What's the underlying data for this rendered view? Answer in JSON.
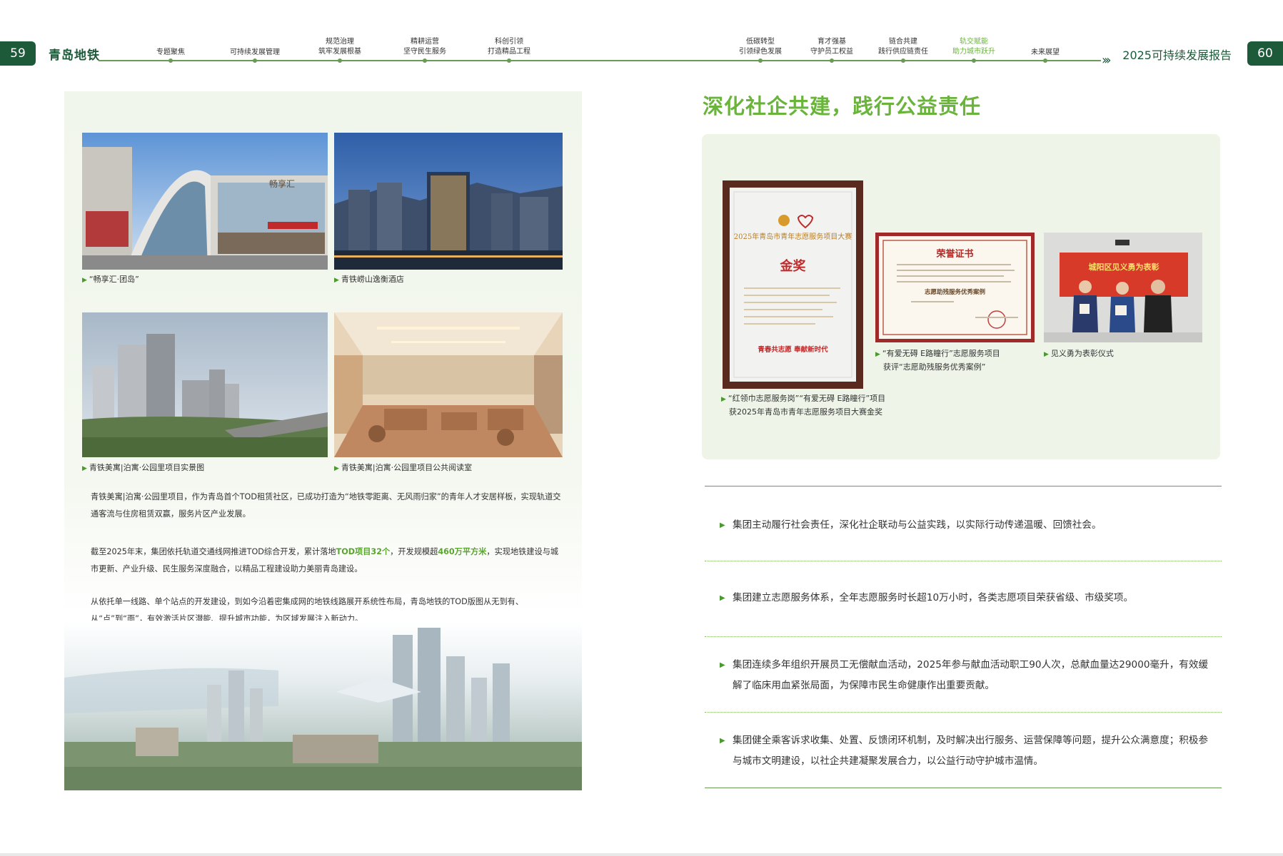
{
  "header": {
    "left_page_num": "59",
    "right_page_num": "60",
    "brand": "青岛地铁",
    "report_title": "2025可持续发展报告",
    "nav": [
      {
        "l1": "专题聚焦",
        "l2": ""
      },
      {
        "l1": "可持续发展管理",
        "l2": ""
      },
      {
        "l1": "规范治理",
        "l2": "筑牢发展根基"
      },
      {
        "l1": "精耕运营",
        "l2": "坚守民生服务"
      },
      {
        "l1": "科创引领",
        "l2": "打造精品工程"
      },
      {
        "l1": "低碳转型",
        "l2": "引领绿色发展"
      },
      {
        "l1": "育才强基",
        "l2": "守护员工权益"
      },
      {
        "l1": "链合共建",
        "l2": "践行供应链责任"
      },
      {
        "l1": "轨交赋能",
        "l2": "助力城市跃升"
      },
      {
        "l1": "未来展望",
        "l2": ""
      }
    ]
  },
  "left": {
    "captions": {
      "c1": "“畅享汇·团岛”",
      "c2": "青铁崂山逸衡酒店",
      "c3": "青铁美寓|泊寓·公园里项目实景图",
      "c4": "青铁美寓|泊寓·公园里项目公共阅读室"
    },
    "para1": "青铁美寓|泊寓·公园里项目，作为青岛首个TOD租赁社区，已成功打造为“地铁零距离、无风雨归家”的青年人才安居样板，实现轨道交通客流与住房租赁双赢，服务片区产业发展。",
    "para2_pre": "截至2025年末，集团依托轨道交通线网推进TOD综合开发，累计落地",
    "para2_hl1": "TOD项目32个",
    "para2_mid": "，开发规模超",
    "para2_hl2": "460万平方米",
    "para2_post": "，实现地铁建设与城市更新、产业升级、民生服务深度融合，以精品工程建设助力美丽青岛建设。",
    "para3": "从依托单一线路、单个站点的开发建设，到如今沿着密集成网的地铁线路展开系统性布局，青岛地铁的TOD版图从无到有、从“点”到“面”，有效激活片区潜能、提升城市功能，为区域发展注入新动力。",
    "sign_text": "畅享汇"
  },
  "right": {
    "title": "深化社企共建，践行公益责任",
    "award1": {
      "plaque_title": "2025年青岛市青年志愿服务项目大赛",
      "plaque_prize": "金奖",
      "plaque_slogan": "青春共志愿 奉献新时代",
      "caption_l1": "“红领巾志愿服务岗”“有爱无碍 E路瞳行”项目",
      "caption_l2": "获2025年青岛市青年志愿服务项目大赛金奖"
    },
    "award2": {
      "cert_title": "荣誉证书",
      "cert_case": "志愿助残服务优秀案例",
      "caption_l1": "“有爱无碍 E路瞳行”志愿服务项目",
      "caption_l2": "获评“志愿助残服务优秀案例”"
    },
    "award3": {
      "banner": "城阳区见义勇为表彰",
      "caption": "见义勇为表彰仪式"
    },
    "bullets": [
      "集团主动履行社会责任，深化社企联动与公益实践，以实际行动传递温暖、回馈社会。",
      "集团建立志愿服务体系，全年志愿服务时长超10万小时，各类志愿项目荣获省级、市级奖项。",
      "集团连续多年组织开展员工无偿献血活动，2025年参与献血活动职工90人次，总献血量达29000毫升，有效缓解了临床用血紧张局面，为保障市民生命健康作出重要贡献。",
      "集团健全乘客诉求收集、处置、反馈闭环机制，及时解决出行服务、运营保障等问题，提升公众满意度；积极参与城市文明建设，以社企共建凝聚发展合力，以公益行动守护城市温情。"
    ]
  },
  "colors": {
    "brand_green": "#1d5a3a",
    "accent_green": "#6ab43c",
    "panel_bg": "#eef5e8"
  }
}
